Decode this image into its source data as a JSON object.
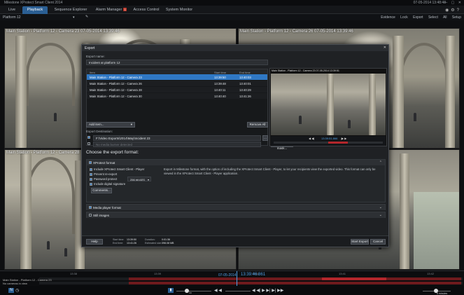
{
  "app": {
    "title": "Milestone XProtect Smart Client 2014",
    "clock": "07-05-2014 13:48:48",
    "window_buttons": "— ▢ ✕"
  },
  "tabs": [
    {
      "label": "Live",
      "badge": ""
    },
    {
      "label": "Playback",
      "badge": ""
    },
    {
      "label": "Sequence Explorer",
      "badge": ""
    },
    {
      "label": "Alarm Manager",
      "badge": "1"
    },
    {
      "label": "Access Control",
      "badge": ""
    },
    {
      "label": "System Monitor",
      "badge": ""
    }
  ],
  "toolbar": {
    "view_label": "Platform 12",
    "view_caret": "▾",
    "tool_icon": "✎",
    "evidence_lock": "Evidence Lock",
    "export": "Export",
    "select_all": "Select All",
    "setup": "Setup"
  },
  "cameras": [
    {
      "label": "Main Station - Platform 12 - Camera 23   07-05-2014 13:39:46"
    },
    {
      "label": "Main Station - Platform 12 - Camera 26   07-05-2014 13:39:46"
    },
    {
      "label": "Main Station - Platform 12 - Camera 28"
    },
    {
      "label": ""
    }
  ],
  "dialog": {
    "title": "Export",
    "export_name_label": "Export name:",
    "export_name_value": "Incident at platform 12",
    "list_headers": {
      "item": "Item",
      "start": "Start time",
      "end": "End time"
    },
    "items": [
      {
        "item": "Main Station - Platform 12 - Camera 23",
        "start": "13:39:50",
        "end": "13:40:03",
        "selected": true
      },
      {
        "item": "Main Station - Platform 12 - Camera 26",
        "start": "13:39:48",
        "end": "13:40:01",
        "selected": false
      },
      {
        "item": "Main Station - Platform 12 - Camera 28",
        "start": "13:40:11",
        "end": "13:40:29",
        "selected": false
      },
      {
        "item": "Main Station - Platform 12 - Camera 30",
        "start": "13:40:40",
        "end": "13:41:26",
        "selected": false
      }
    ],
    "add_item": "Add item...",
    "remove_all": "Remove All",
    "destination_label": "Export Destination:",
    "destination_path": "F:\\Video Exports\\2014\\May\\Incident 23",
    "media_burner": "No media burner detected",
    "browse": "...",
    "privacy_mask": "Privacy mask...",
    "preview_title": "Main Station - Platform 12 - Camera 23   07-05-2014 13:39:51",
    "preview_time": "13:39:51.866",
    "format_title": "Choose the export format:",
    "xprotect": {
      "title": "XProtect format",
      "chevron": "⌃",
      "options": [
        {
          "label": "Include XProtect Smart Client - Player",
          "checked": true
        },
        {
          "label": "Prevent re-export",
          "checked": true
        },
        {
          "label": "Password protect",
          "checked": true
        },
        {
          "label": "Include digital signature",
          "checked": true
        }
      ],
      "encryption": "256 bit AES",
      "comments": "Comments...",
      "description": "Export in Milestone format, with the option of including the XProtect Smart Client - Player, to let your recipients view the exported video. This format can only be viewed in the XProtect Smart Client - Player application."
    },
    "media_player": {
      "title": "Media player format",
      "checked": true
    },
    "still_images": {
      "title": "Still images",
      "checked": false
    },
    "footer": {
      "help": "Help",
      "start_time_label": "Start time:",
      "start_time": "13:39:50",
      "end_time_label": "End time:",
      "end_time": "13:41:26",
      "duration_label": "Duration:",
      "duration": "0:01:36",
      "size_label": "Estimated size:",
      "size": "398.08 MB",
      "start_export": "Start Export",
      "cancel": "Cancel"
    }
  },
  "timeline": {
    "ticks": [
      "13:38",
      "13:39",
      "13:40",
      "13:41",
      "13:42"
    ],
    "date": "07-05-2014",
    "time": "13:39:46.861",
    "row_labels": [
      "Main Station - Platform 12 - Camera 23",
      "No cameras in view"
    ]
  },
  "controls": {
    "mode": "N",
    "speed": "1x",
    "playback_buttons": "◀  ◀|   ▶  ▶|  ▶|  ▶▶",
    "zoom": "5 minutes"
  }
}
